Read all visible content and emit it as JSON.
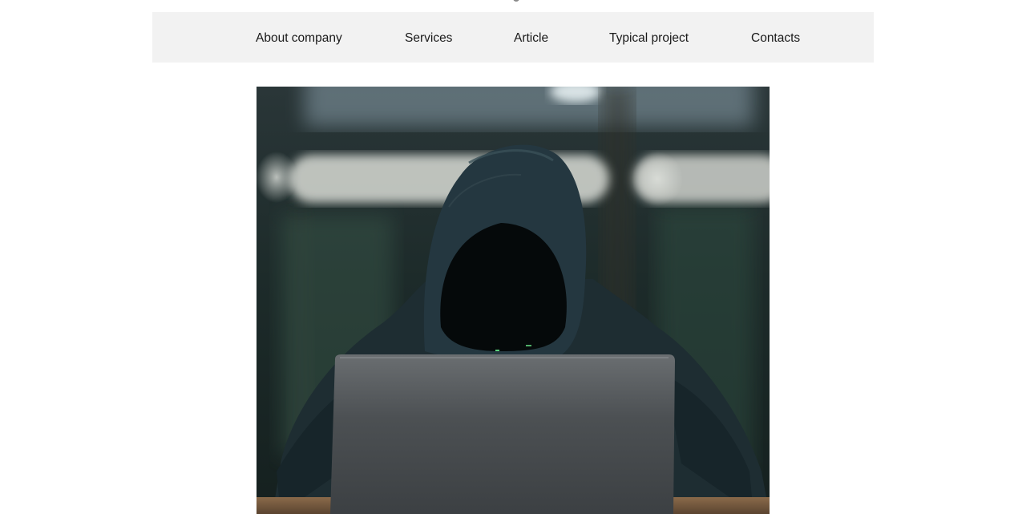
{
  "nav": {
    "items": [
      {
        "label": "About company"
      },
      {
        "label": "Services"
      },
      {
        "label": "Article"
      },
      {
        "label": "Typical project"
      },
      {
        "label": "Contacts"
      }
    ]
  },
  "hero": {
    "image": "hooded-figure-at-laptop-photo",
    "colors": {
      "background_dark": "#1c2a2a",
      "hoodie": "#1f2e33",
      "laptop": "#4e5256",
      "light_strip": "#d8dbd6"
    }
  }
}
